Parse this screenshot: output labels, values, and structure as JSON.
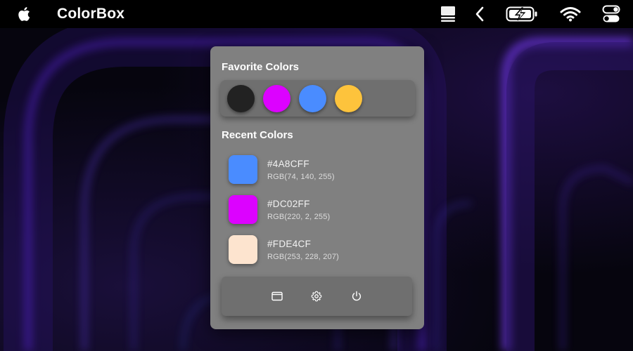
{
  "menubar": {
    "app_name": "ColorBox",
    "icons": [
      "apple-logo-icon",
      "dock-icon",
      "chevron-left-icon",
      "battery-charging-icon",
      "wifi-icon",
      "control-center-icon"
    ]
  },
  "favorites": {
    "title": "Favorite Colors",
    "colors": [
      "#222222",
      "#DC02FF",
      "#4A8CFF",
      "#FDC33C"
    ]
  },
  "recent": {
    "title": "Recent Colors",
    "items": [
      {
        "hex": "#4A8CFF",
        "rgb": "RGB(74, 140, 255)",
        "swatch": "#4A8CFF"
      },
      {
        "hex": "#DC02FF",
        "rgb": "RGB(220, 2, 255)",
        "swatch": "#DC02FF"
      },
      {
        "hex": "#FDE4CF",
        "rgb": "RGB(253, 228, 207)",
        "swatch": "#FDE4CF"
      }
    ]
  },
  "toolbar": {
    "buttons": [
      "window-icon",
      "gear-icon",
      "power-icon"
    ]
  },
  "theme": {
    "panel_bg": "#808080",
    "tray_bg": "#6F6F6F",
    "menubar_bg": "#000000",
    "wallpaper_glow": "#7B3CFF"
  }
}
